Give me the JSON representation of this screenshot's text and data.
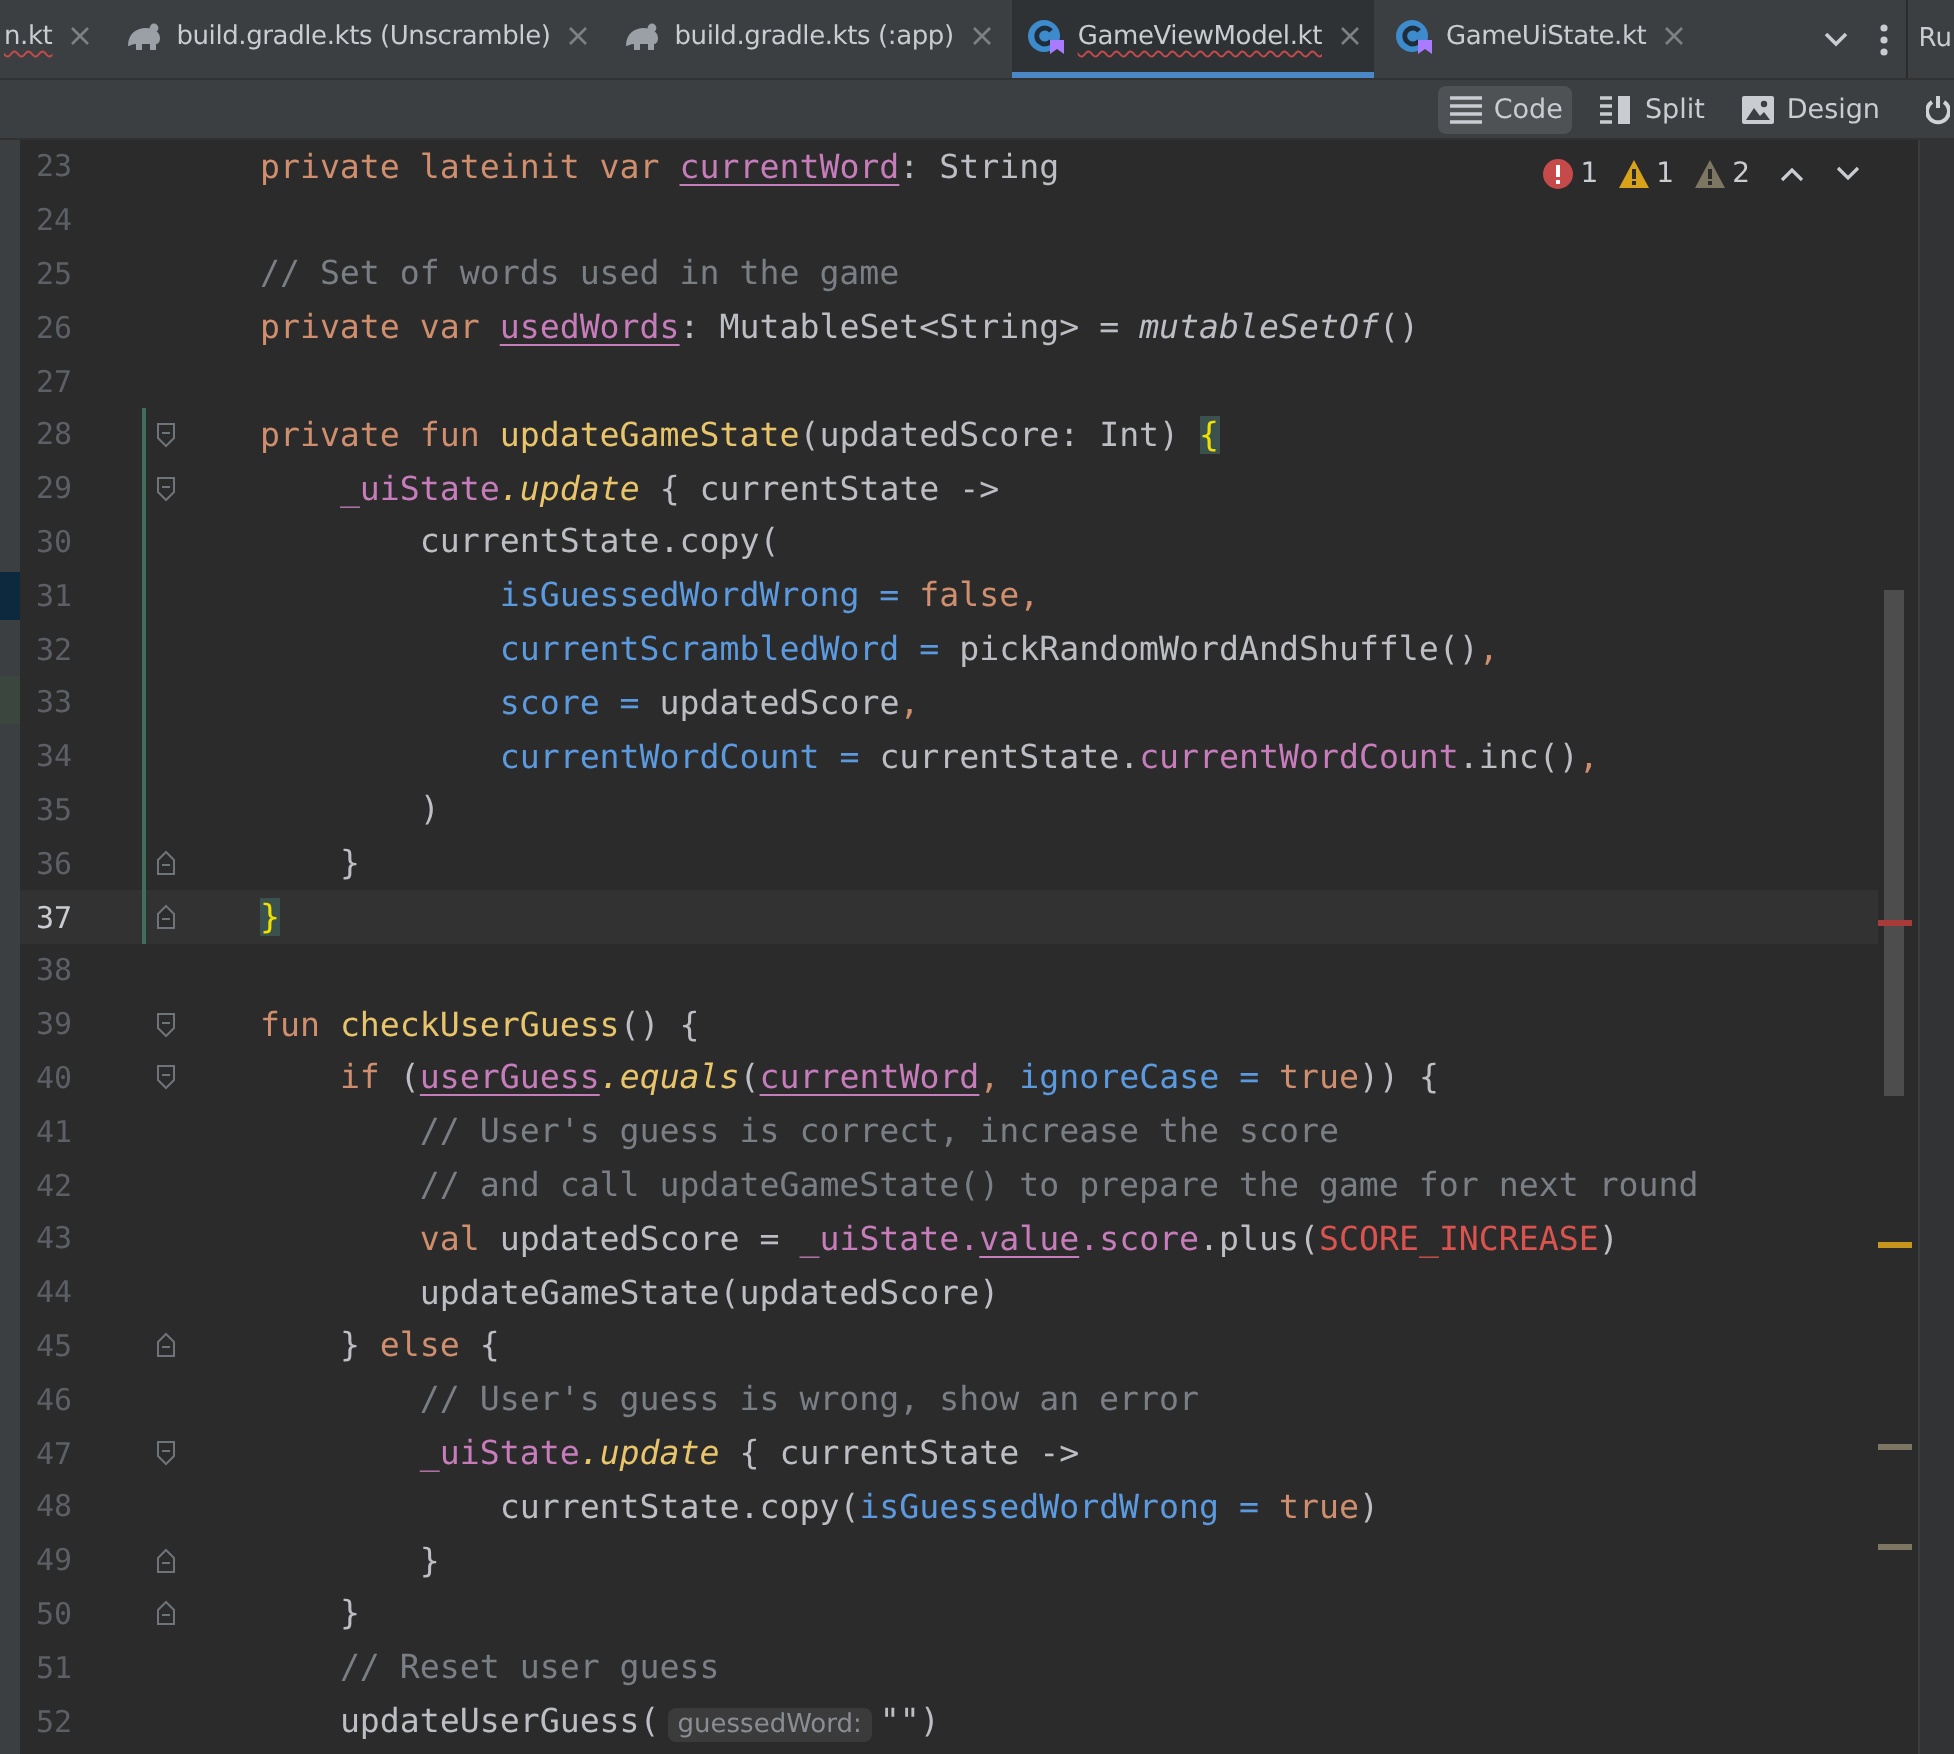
{
  "tabs": [
    {
      "label": "n.kt",
      "kind": "plain",
      "selected": false,
      "error": true
    },
    {
      "label": "build.gradle.kts (Unscramble)",
      "kind": "gradle",
      "selected": false,
      "error": false
    },
    {
      "label": "build.gradle.kts (:app)",
      "kind": "gradle",
      "selected": false,
      "error": false
    },
    {
      "label": "GameViewModel.kt",
      "kind": "kotlin_class",
      "selected": true,
      "error": true
    },
    {
      "label": "GameUiState.kt",
      "kind": "kotlin_class",
      "selected": false,
      "error": false
    }
  ],
  "right_tab_fragment": "Ru",
  "view_modes": [
    {
      "label": "Code",
      "kind": "lines",
      "selected": true
    },
    {
      "label": "Split",
      "kind": "split",
      "selected": false
    },
    {
      "label": "Design",
      "kind": "image",
      "selected": false
    }
  ],
  "inspections": {
    "errors": "1",
    "warnings": "1",
    "weak_warnings": "2"
  },
  "lines": [
    {
      "num": "23",
      "current": false,
      "changed": false,
      "fold_start": false,
      "fold_end": false,
      "tokens": [
        {
          "t": "    private lateinit var ",
          "kind": "kw"
        },
        {
          "t": "currentWord",
          "kind": "prop_u"
        },
        {
          "t": ": String",
          "kind": "plain"
        }
      ]
    },
    {
      "num": "24",
      "current": false,
      "changed": false,
      "fold_start": false,
      "fold_end": false
    },
    {
      "num": "25",
      "current": false,
      "changed": false,
      "fold_start": false,
      "fold_end": false,
      "tokens": [
        {
          "t": "    // Set of words used in the game",
          "kind": "comment"
        }
      ]
    },
    {
      "num": "26",
      "current": false,
      "changed": false,
      "fold_start": false,
      "fold_end": false,
      "tokens": [
        {
          "t": "    private var ",
          "kind": "kw"
        },
        {
          "t": "usedWords",
          "kind": "prop_u"
        },
        {
          "t": ": MutableSet<String> = ",
          "kind": "plain"
        },
        {
          "t": "mutableSetOf",
          "kind": "italic"
        },
        {
          "t": "()",
          "kind": "plain"
        }
      ]
    },
    {
      "num": "27",
      "current": false,
      "changed": false,
      "fold_start": false,
      "fold_end": false
    },
    {
      "num": "28",
      "current": false,
      "changed": true,
      "fold_start": true,
      "fold_end": false,
      "tokens": [
        {
          "t": "    private fun ",
          "kind": "kw"
        },
        {
          "t": "updateGameState",
          "kind": "fn"
        },
        {
          "t": "(updatedScore: Int) ",
          "kind": "plain"
        },
        {
          "t": "{",
          "kind": "brace"
        }
      ]
    },
    {
      "num": "29",
      "current": false,
      "changed": true,
      "fold_start": true,
      "fold_end": false,
      "tokens": [
        {
          "t": "        _uiState",
          "kind": "prop"
        },
        {
          "t": ".update",
          "kind": "ext"
        },
        {
          "t": " { currentState ->",
          "kind": "plain"
        }
      ]
    },
    {
      "num": "30",
      "current": false,
      "changed": true,
      "fold_start": false,
      "fold_end": false,
      "tokens": [
        {
          "t": "            currentState.copy(",
          "kind": "plain"
        }
      ]
    },
    {
      "num": "31",
      "current": false,
      "changed": true,
      "fold_start": false,
      "fold_end": false,
      "tokens": [
        {
          "t": "                isGuessedWordWrong = ",
          "kind": "arg"
        },
        {
          "t": "false,",
          "kind": "kw"
        }
      ]
    },
    {
      "num": "32",
      "current": false,
      "changed": true,
      "fold_start": false,
      "fold_end": false,
      "tokens": [
        {
          "t": "                currentScrambledWord = ",
          "kind": "arg"
        },
        {
          "t": "pickRandomWordAndShuffle()",
          "kind": "plain"
        },
        {
          "t": ",",
          "kind": "kw"
        }
      ]
    },
    {
      "num": "33",
      "current": false,
      "changed": true,
      "fold_start": false,
      "fold_end": false,
      "tokens": [
        {
          "t": "                score = ",
          "kind": "arg"
        },
        {
          "t": "updatedScore",
          "kind": "plain"
        },
        {
          "t": ",",
          "kind": "kw"
        }
      ]
    },
    {
      "num": "34",
      "current": false,
      "changed": true,
      "fold_start": false,
      "fold_end": false,
      "tokens": [
        {
          "t": "                currentWordCount = ",
          "kind": "arg"
        },
        {
          "t": "currentState.",
          "kind": "plain"
        },
        {
          "t": "currentWordCount",
          "kind": "prop"
        },
        {
          "t": ".inc()",
          "kind": "plain"
        },
        {
          "t": ",",
          "kind": "kw"
        }
      ]
    },
    {
      "num": "35",
      "current": false,
      "changed": true,
      "fold_start": false,
      "fold_end": false,
      "tokens": [
        {
          "t": "            )",
          "kind": "plain"
        }
      ]
    },
    {
      "num": "36",
      "current": false,
      "changed": true,
      "fold_start": false,
      "fold_end": true,
      "tokens": [
        {
          "t": "        }",
          "kind": "plain"
        }
      ]
    },
    {
      "num": "37",
      "current": true,
      "changed": true,
      "fold_start": false,
      "fold_end": true,
      "tokens": [
        {
          "t": "    }",
          "kind": "brace"
        }
      ]
    },
    {
      "num": "38",
      "current": false,
      "changed": false,
      "fold_start": false,
      "fold_end": false
    },
    {
      "num": "39",
      "current": false,
      "changed": false,
      "fold_start": true,
      "fold_end": false,
      "tokens": [
        {
          "t": "    fun ",
          "kind": "kw"
        },
        {
          "t": "checkUserGuess",
          "kind": "fn"
        },
        {
          "t": "() {",
          "kind": "plain"
        }
      ]
    },
    {
      "num": "40",
      "current": false,
      "changed": false,
      "fold_start": true,
      "fold_end": false,
      "tokens": [
        {
          "t": "        if ",
          "kind": "kw"
        },
        {
          "t": "(",
          "kind": "plain"
        },
        {
          "t": "userGuess",
          "kind": "prop_u"
        },
        {
          "t": ".equals",
          "kind": "ext"
        },
        {
          "t": "(",
          "kind": "plain"
        },
        {
          "t": "currentWord",
          "kind": "prop_u"
        },
        {
          "t": ", ",
          "kind": "kw"
        },
        {
          "t": "ignoreCase = ",
          "kind": "arg"
        },
        {
          "t": "true",
          "kind": "kw"
        },
        {
          "t": ")) {",
          "kind": "plain"
        }
      ]
    },
    {
      "num": "41",
      "current": false,
      "changed": false,
      "fold_start": false,
      "fold_end": false,
      "tokens": [
        {
          "t": "            // User's guess is correct, increase the score",
          "kind": "comment"
        }
      ]
    },
    {
      "num": "42",
      "current": false,
      "changed": false,
      "fold_start": false,
      "fold_end": false,
      "tokens": [
        {
          "t": "            // and call updateGameState() to prepare the game for next round",
          "kind": "comment"
        }
      ]
    },
    {
      "num": "43",
      "current": false,
      "changed": false,
      "fold_start": false,
      "fold_end": false,
      "tokens": [
        {
          "t": "            val ",
          "kind": "kw"
        },
        {
          "t": "updatedScore = ",
          "kind": "plain"
        },
        {
          "t": "_uiState.",
          "kind": "prop"
        },
        {
          "t": "value",
          "kind": "prop_u"
        },
        {
          "t": ".score",
          "kind": "prop"
        },
        {
          "t": ".plus(",
          "kind": "plain"
        },
        {
          "t": "SCORE_INCREASE",
          "kind": "error"
        },
        {
          "t": ")",
          "kind": "plain"
        }
      ]
    },
    {
      "num": "44",
      "current": false,
      "changed": false,
      "fold_start": false,
      "fold_end": false,
      "tokens": [
        {
          "t": "            updateGameState(updatedScore)",
          "kind": "plain"
        }
      ]
    },
    {
      "num": "45",
      "current": false,
      "changed": false,
      "fold_start": false,
      "fold_end": true,
      "tokens": [
        {
          "t": "        } ",
          "kind": "plain"
        },
        {
          "t": "else",
          "kind": "kw"
        },
        {
          "t": " {",
          "kind": "plain"
        }
      ]
    },
    {
      "num": "46",
      "current": false,
      "changed": false,
      "fold_start": false,
      "fold_end": false,
      "tokens": [
        {
          "t": "            // User's guess is wrong, show an error",
          "kind": "comment"
        }
      ]
    },
    {
      "num": "47",
      "current": false,
      "changed": false,
      "fold_start": true,
      "fold_end": false,
      "tokens": [
        {
          "t": "            _uiState",
          "kind": "prop"
        },
        {
          "t": ".update",
          "kind": "ext"
        },
        {
          "t": " { currentState ->",
          "kind": "plain"
        }
      ]
    },
    {
      "num": "48",
      "current": false,
      "changed": false,
      "fold_start": false,
      "fold_end": false,
      "tokens": [
        {
          "t": "                currentState.copy(",
          "kind": "plain"
        },
        {
          "t": "isGuessedWordWrong = ",
          "kind": "arg"
        },
        {
          "t": "true",
          "kind": "kw"
        },
        {
          "t": ")",
          "kind": "plain"
        }
      ]
    },
    {
      "num": "49",
      "current": false,
      "changed": false,
      "fold_start": false,
      "fold_end": true,
      "tokens": [
        {
          "t": "            }",
          "kind": "plain"
        }
      ]
    },
    {
      "num": "50",
      "current": false,
      "changed": false,
      "fold_start": false,
      "fold_end": true,
      "tokens": [
        {
          "t": "        }",
          "kind": "plain"
        }
      ]
    },
    {
      "num": "51",
      "current": false,
      "changed": false,
      "fold_start": false,
      "fold_end": false,
      "tokens": [
        {
          "t": "        // Reset user guess",
          "kind": "comment"
        }
      ]
    },
    {
      "num": "52",
      "current": false,
      "changed": false,
      "fold_start": false,
      "fold_end": false,
      "tokens": [
        {
          "t": "        updateUserGuess(",
          "kind": "plain"
        },
        {
          "t": "guessedWord:",
          "kind": "hint"
        },
        {
          "t": "\"\")",
          "kind": "plain"
        }
      ]
    }
  ]
}
